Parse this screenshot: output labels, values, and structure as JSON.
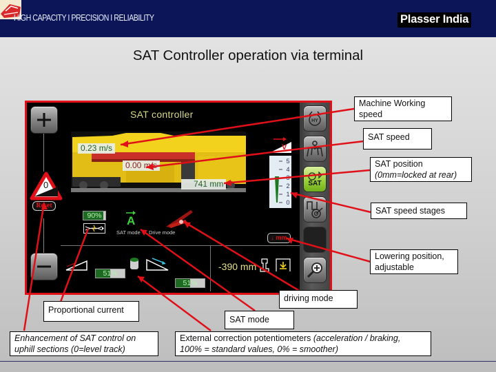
{
  "header": {
    "tagline": "HIGH CAPACITY I PRECISION I RELIABILITY",
    "brand": "Plasser India",
    "logo_icon": "train-logo-icon",
    "banner_color": "#0b1558"
  },
  "page_title": "SAT Controller operation via terminal",
  "terminal": {
    "title": "SAT controller",
    "plus_icon": "plus-icon",
    "minus_icon": "minus-icon",
    "uphill_value": "0",
    "reset_label": "Reset",
    "machine_working_speed": "0.23 m/s",
    "sat_speed": "0.00 m/s",
    "sat_position": "741 mm",
    "speed_gauge": {
      "marker": "V",
      "scale": [
        "5",
        "4",
        "3",
        "2",
        "1",
        "0"
      ]
    },
    "proportional_current": "90%",
    "proportional_current_value": 0.9,
    "sat_mode_label": "SAT mode",
    "sat_mode_glyph": "A",
    "drive_mode_label": "Drive mode",
    "lowering_button_label": "↓ mm",
    "accel_potentiometer": "51%",
    "accel_potentiometer_value": 0.51,
    "brake_potentiometer": "51%",
    "brake_potentiometer_value": 0.51,
    "lowering_position": "-390 mm",
    "side_buttons": [
      {
        "name": "hydraulic-button",
        "icon": "hydraulic-icon",
        "label": "HY"
      },
      {
        "name": "lift-button",
        "icon": "lift-icon",
        "label": ""
      },
      {
        "name": "sat-button",
        "icon": "sat-hydraulic-icon",
        "label": "SAT"
      },
      {
        "name": "signal-button",
        "icon": "signal-target-icon",
        "label": ""
      },
      {
        "name": "blank-button",
        "icon": "",
        "label": ""
      },
      {
        "name": "zoom-button",
        "icon": "zoom-in-icon",
        "label": ""
      }
    ],
    "accent_color": "#e01018"
  },
  "callouts": {
    "machine_working_speed": "Machine Working speed",
    "machine_working_speed_l1": "Machine Working",
    "machine_working_speed_l2": "speed",
    "sat_speed": "SAT speed",
    "sat_position_l1": "SAT position",
    "sat_position_l2": "(0mm=locked at rear)",
    "sat_speed_stages": "SAT speed stages",
    "lowering_l1": "Lowering position,",
    "lowering_l2": "adjustable",
    "driving_mode": "driving mode",
    "proportional_current": "Proportional current",
    "sat_mode": "SAT mode",
    "enhancement_l1": "Enhancement of SAT control on",
    "enhancement_l2": "uphill sections (0=level track)",
    "external_l1_plain": "External correction potentiometers ",
    "external_l1_italic": "(acceleration / braking,",
    "external_l2": "100% = standard values, 0% = smoother)"
  }
}
